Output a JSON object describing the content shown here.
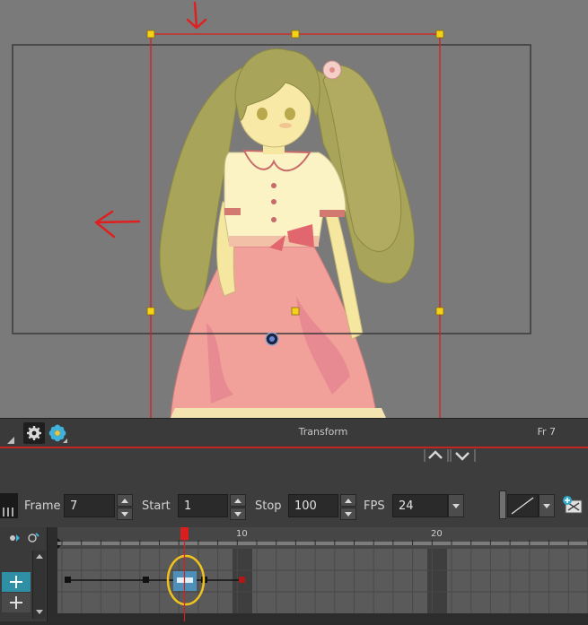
{
  "view": {
    "name": "Transform",
    "frame_indicator": "Fr 7"
  },
  "controls": {
    "frame_label": "Frame",
    "frame_value": "7",
    "start_label": "Start",
    "start_value": "1",
    "stop_label": "Stop",
    "stop_value": "100",
    "fps_label": "FPS",
    "fps_value": "24"
  },
  "timeline": {
    "ruler_labels": [
      "10",
      "20"
    ],
    "current_frame": 7
  },
  "colors": {
    "viewport_bg": "#7a7a7a",
    "annotation_red": "#e02020",
    "selection_red": "#d81e1e",
    "handle_yellow": "#f4d21a",
    "highlight_ring": "#f2c21c",
    "keyframe_blue": "#4c8fb8",
    "add_layer_teal": "#2e8fa5"
  },
  "icons": {
    "arrow_down": "arrow-down-icon",
    "arrow_left": "arrow-left-icon",
    "gear": "gear-icon",
    "flower": "flower-icon",
    "chevron_up": "chevron-up-icon",
    "chevron_down": "chevron-down-icon",
    "plus": "plus-icon",
    "line_tool": "line-icon",
    "add_key": "add-key-icon"
  }
}
